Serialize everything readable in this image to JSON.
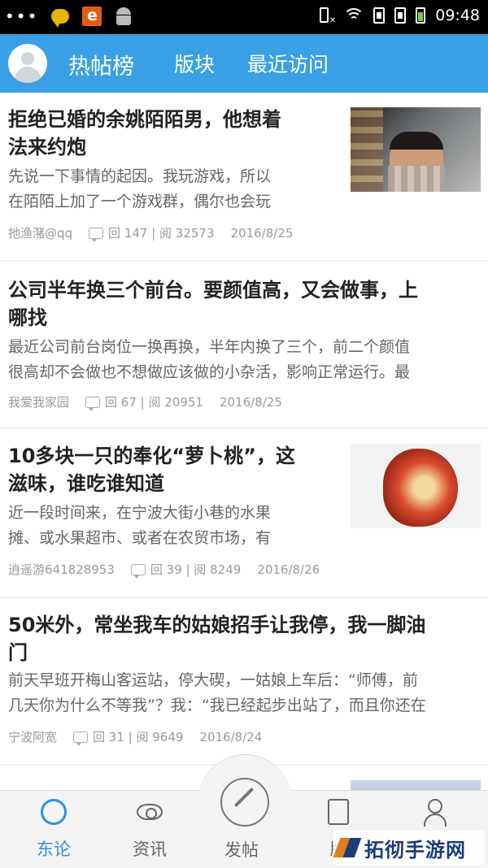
{
  "statusbar": {
    "time": "09:48",
    "e_icon": "e"
  },
  "appbar": {
    "tabs": [
      {
        "label": "热帖榜"
      },
      {
        "label": "版块"
      },
      {
        "label": "最近访问"
      }
    ]
  },
  "posts": [
    {
      "title_l1": "拒绝已婚的余姚陌陌男，他想着",
      "title_l2": "法来约炮",
      "snippet_l1": "先说一下事情的起因。我玩游戏，所以",
      "snippet_l2": "在陌陌上加了一个游戏群，偶尔也会玩",
      "author": "扡渔潴@qq",
      "stats": "回 147 | 阅 32573",
      "date": "2016/8/25"
    },
    {
      "title_l1": "公司半年换三个前台。要颜值高，又会做事，上",
      "title_l2": "哪找",
      "snippet_l1": "最近公司前台岗位一换再换，半年内换了三个，前二个颜值",
      "snippet_l2": "很高却不会做也不想做应该做的小杂活，影响正常运行。最",
      "author": "我爱我家园",
      "stats": "回 67 | 阅 20951",
      "date": "2016/8/25"
    },
    {
      "title_l1": "10多块一只的奉化“萝卜桃”，这",
      "title_l2": "滋味，谁吃谁知道",
      "snippet_l1": "近一段时间来，在宁波大街小巷的水果",
      "snippet_l2": "摊、或水果超市、或者在农贸市场，有",
      "author": "逍遥游641828953",
      "stats": "回 39 | 阅 8249",
      "date": "2016/8/26"
    },
    {
      "title_l1": "50米外，常坐我车的姑娘招手让我停，我一脚油",
      "title_l2": "门",
      "snippet_l1": "前天早班开梅山客运站，停大碶，一姑娘上车后：“师傅，前",
      "snippet_l2": "几天你为什么不等我”？我：“我已经起步出站了，而且你还在",
      "author": "宁波阿宽",
      "stats": "回 31 | 阅 9649",
      "date": "2016/8/24"
    }
  ],
  "tabbar": {
    "tabs": [
      {
        "label": "东论",
        "icon": "chat-bubble-icon"
      },
      {
        "label": "资讯",
        "icon": "eye-icon"
      },
      {
        "label": "发帖",
        "icon": "pen-icon"
      },
      {
        "label": "版",
        "icon": "document-icon"
      },
      {
        "label": "",
        "icon": "user-icon"
      }
    ]
  },
  "watermark": {
    "text": "拓彻手游网"
  },
  "colors": {
    "accent": "#3aa0e6",
    "active_tab": "#2f8fdc"
  }
}
